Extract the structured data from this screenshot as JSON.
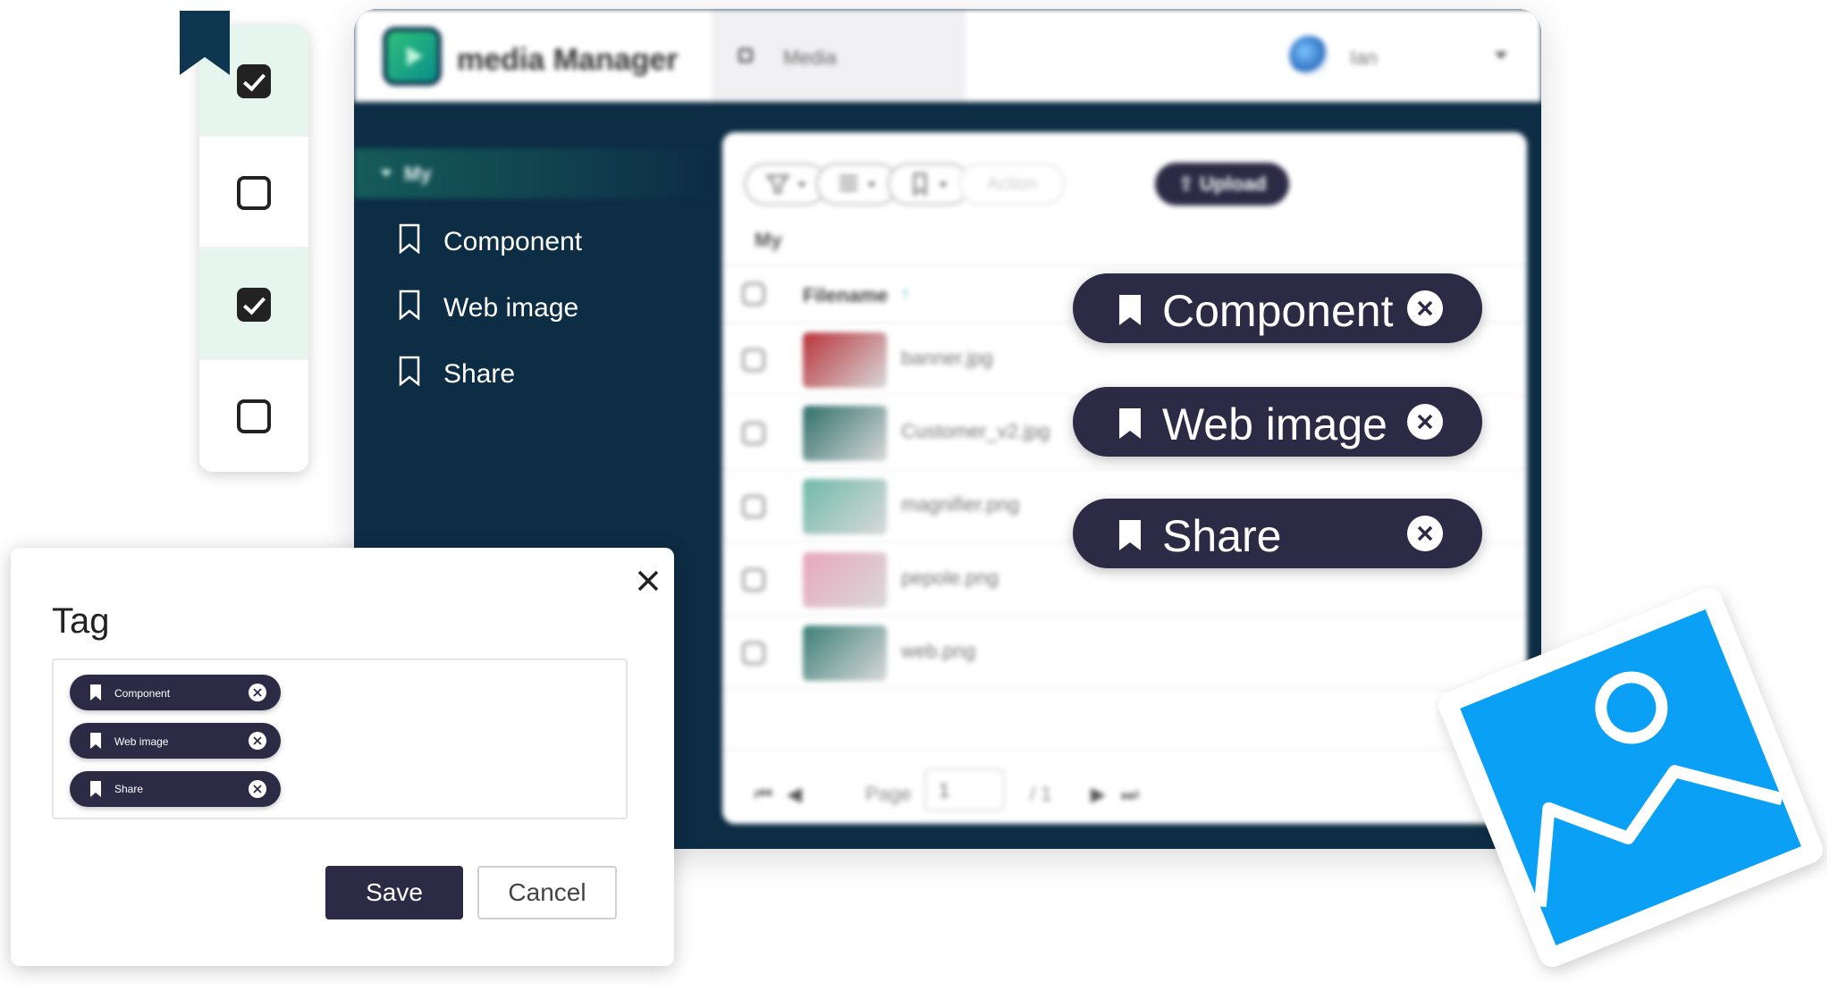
{
  "app": {
    "title": "media Manager",
    "header_tab_label": "Media",
    "user_name": "Ian"
  },
  "sidebar": {
    "group_label": "My",
    "items": [
      {
        "label": "Component",
        "icon": "bookmark-outline-icon"
      },
      {
        "label": "Web image",
        "icon": "bookmark-outline-icon"
      },
      {
        "label": "Share",
        "icon": "bookmark-outline-icon"
      }
    ]
  },
  "toolbar": {
    "action_label": "Action",
    "upload_label": "Upload"
  },
  "content": {
    "breadcrumb": "My",
    "column_filename": "Filename",
    "sort_indicator": "↑",
    "files": [
      {
        "name": "banner.jpg",
        "thumb_color": "#b8333a"
      },
      {
        "name": "Customer_v2.jpg",
        "thumb_color": "#2f6f6a"
      },
      {
        "name": "magnifier.png",
        "thumb_color": "#6fb9a8"
      },
      {
        "name": "pepole.png",
        "thumb_color": "#e9a7bd"
      },
      {
        "name": "web.png",
        "thumb_color": "#3c7f77"
      }
    ],
    "pager": {
      "page_label": "Page",
      "page_value": "1",
      "page_total": "/ 1"
    }
  },
  "check_column": {
    "states": [
      true,
      false,
      true,
      false
    ]
  },
  "floating_tags": [
    {
      "label": "Component"
    },
    {
      "label": "Web image"
    },
    {
      "label": "Share"
    }
  ],
  "dialog": {
    "title": "Tag",
    "tags": [
      {
        "label": "Component"
      },
      {
        "label": "Web image"
      },
      {
        "label": "Share"
      }
    ],
    "save_label": "Save",
    "cancel_label": "Cancel"
  },
  "colors": {
    "chip_bg": "#2c2a45",
    "app_dark": "#0d2d45",
    "accent_blue": "#0aa0f5"
  }
}
